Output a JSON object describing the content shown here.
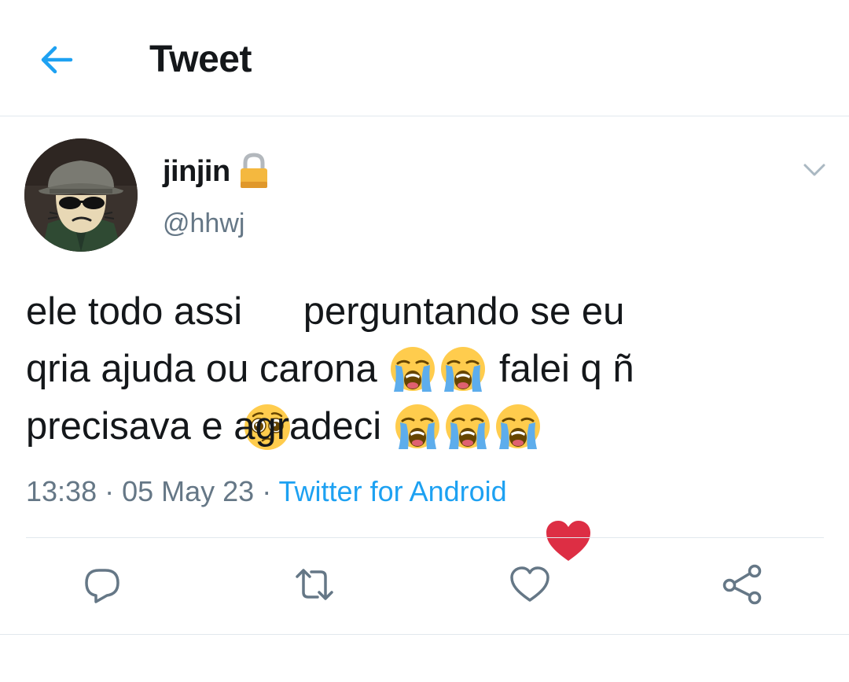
{
  "header": {
    "title": "Tweet",
    "back_icon": "arrow-left-icon"
  },
  "author": {
    "display_name": "jinjin",
    "handle": "@hhwj",
    "protected_icon": "lock-icon",
    "menu_icon": "chevron-down-icon"
  },
  "tweet": {
    "lines": [
      {
        "before": "ele todo assi",
        "after": " perguntando se eu"
      },
      {
        "before": "qria ajuda ou carona ",
        "after": " falei q ñ"
      },
      {
        "before": "precisava e agradeci ",
        "after": ""
      }
    ],
    "emoji": [
      "pleading-face",
      "loudly-crying-face",
      "red-heart"
    ]
  },
  "meta": {
    "time": "13:38",
    "sep1": " · ",
    "date": "05 May 23",
    "sep2": " · ",
    "source": "Twitter for Android"
  },
  "actions": [
    "reply-icon",
    "retweet-icon",
    "like-icon",
    "share-icon"
  ],
  "colors": {
    "accent": "#1da1f2",
    "secondary": "#657786",
    "border": "#e1e8ed",
    "heart": "#dd2e44"
  }
}
